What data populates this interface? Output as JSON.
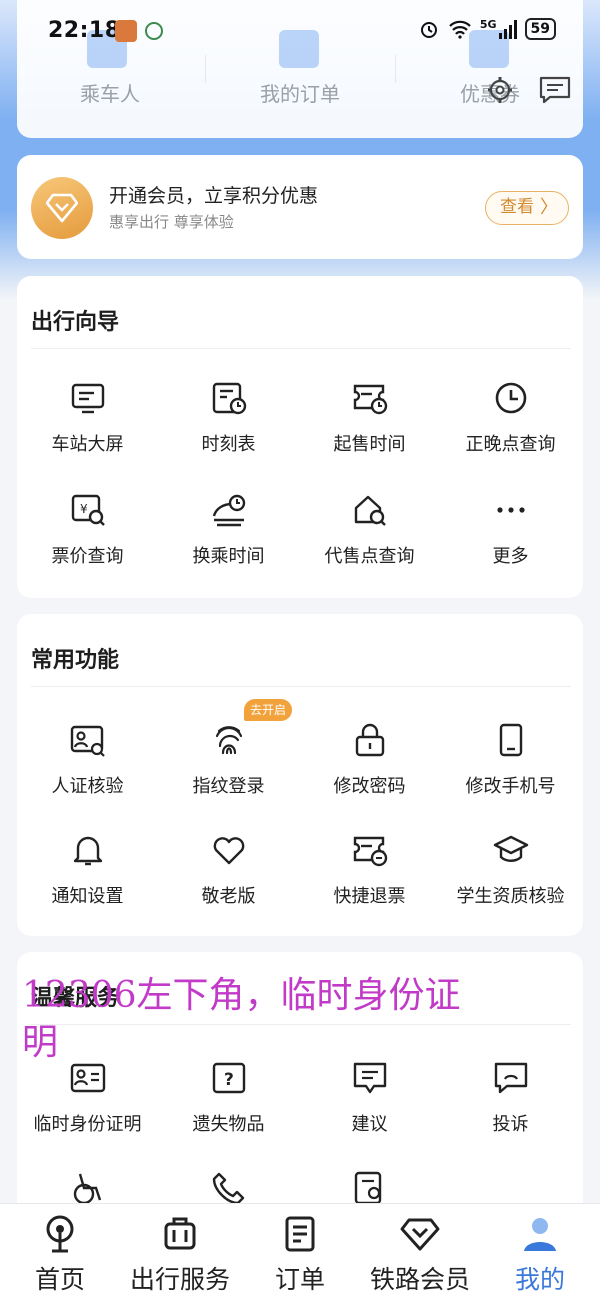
{
  "status_bar": {
    "time": "22:18",
    "network": "5G",
    "battery": "59"
  },
  "top_card": {
    "items": [
      "乘车人",
      "我的订单",
      "优惠券"
    ]
  },
  "member": {
    "title": "开通会员，立享积分优惠",
    "subtitle": "惠享出行 尊享体验",
    "button": "查看",
    "button_arrow": "〉"
  },
  "travel_guide": {
    "title": "出行向导",
    "items": [
      {
        "label": "车站大屏",
        "icon": "station-screen-icon"
      },
      {
        "label": "时刻表",
        "icon": "timetable-icon"
      },
      {
        "label": "起售时间",
        "icon": "sale-time-icon"
      },
      {
        "label": "正晚点查询",
        "icon": "clock-icon"
      },
      {
        "label": "票价查询",
        "icon": "fare-search-icon"
      },
      {
        "label": "换乘时间",
        "icon": "transfer-time-icon"
      },
      {
        "label": "代售点查询",
        "icon": "agency-search-icon"
      },
      {
        "label": "更多",
        "icon": "more-icon"
      }
    ]
  },
  "common_functions": {
    "title": "常用功能",
    "badge": "去开启",
    "items": [
      {
        "label": "人证核验",
        "icon": "id-verify-icon"
      },
      {
        "label": "指纹登录",
        "icon": "fingerprint-icon"
      },
      {
        "label": "修改密码",
        "icon": "lock-icon"
      },
      {
        "label": "修改手机号",
        "icon": "phone-icon"
      },
      {
        "label": "通知设置",
        "icon": "bell-icon"
      },
      {
        "label": "敬老版",
        "icon": "heart-icon"
      },
      {
        "label": "快捷退票",
        "icon": "refund-icon"
      },
      {
        "label": "学生资质核验",
        "icon": "graduation-cap-icon"
      }
    ]
  },
  "warm_service": {
    "title": "温馨服务",
    "items": [
      {
        "label": "临时身份证明",
        "icon": "temp-id-icon"
      },
      {
        "label": "遗失物品",
        "icon": "lost-items-icon"
      },
      {
        "label": "建议",
        "icon": "suggestion-icon"
      },
      {
        "label": "投诉",
        "icon": "complaint-icon"
      }
    ]
  },
  "annotation": "12306左下角，临时身份证明",
  "bottom_nav": [
    {
      "label": "首页",
      "icon": "railway-logo-icon"
    },
    {
      "label": "出行服务",
      "icon": "luggage-icon"
    },
    {
      "label": "订单",
      "icon": "order-icon"
    },
    {
      "label": "铁路会员",
      "icon": "membership-icon"
    },
    {
      "label": "我的",
      "icon": "profile-icon"
    }
  ],
  "colors": {
    "accent": "#3b78dc",
    "annotation": "#c23ac8",
    "member_gold": "#e59b3c"
  }
}
